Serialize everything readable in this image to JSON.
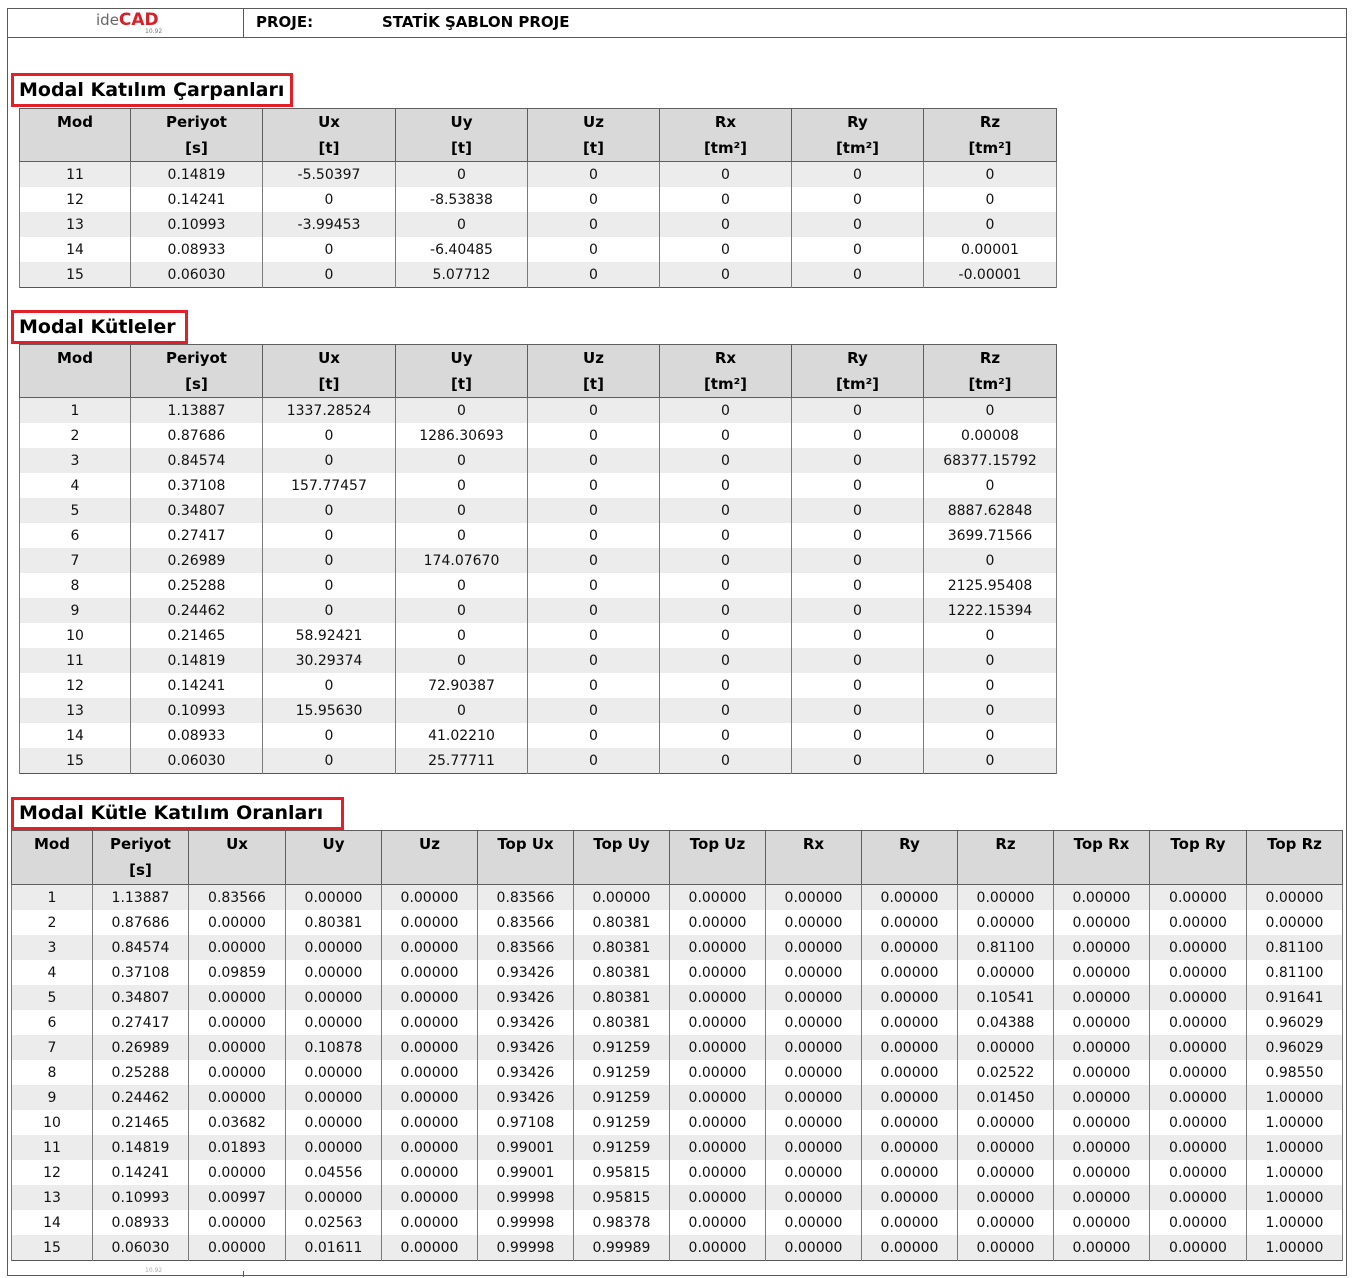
{
  "header": {
    "logo": {
      "prefix": "ide",
      "brand": "CAD",
      "version": "10.92"
    },
    "project_label": "PROJE:",
    "project_name": "STATİK ŞABLON PROJE"
  },
  "colors": {
    "title_border": "#e3202a",
    "header_bg": "#d9d9d9",
    "stripe_bg": "#ececec",
    "brand": "#d71f27"
  },
  "sections": [
    {
      "title": "Modal Katılım Çarpanları",
      "columns": [
        {
          "label": "Mod"
        },
        {
          "label": "Periyot",
          "unit": "[s]"
        },
        {
          "label": "Ux",
          "unit": "[t]"
        },
        {
          "label": "Uy",
          "unit": "[t]"
        },
        {
          "label": "Uz",
          "unit": "[t]"
        },
        {
          "label": "Rx",
          "unit": "[tm²]"
        },
        {
          "label": "Ry",
          "unit": "[tm²]"
        },
        {
          "label": "Rz",
          "unit": "[tm²]"
        }
      ],
      "rows": [
        [
          "11",
          "0.14819",
          "-5.50397",
          "0",
          "0",
          "0",
          "0",
          "0"
        ],
        [
          "12",
          "0.14241",
          "0",
          "-8.53838",
          "0",
          "0",
          "0",
          "0"
        ],
        [
          "13",
          "0.10993",
          "-3.99453",
          "0",
          "0",
          "0",
          "0",
          "0"
        ],
        [
          "14",
          "0.08933",
          "0",
          "-6.40485",
          "0",
          "0",
          "0",
          "0.00001"
        ],
        [
          "15",
          "0.06030",
          "0",
          "5.07712",
          "0",
          "0",
          "0",
          "-0.00001"
        ]
      ]
    },
    {
      "title": "Modal Kütleler",
      "columns": [
        {
          "label": "Mod"
        },
        {
          "label": "Periyot",
          "unit": "[s]"
        },
        {
          "label": "Ux",
          "unit": "[t]"
        },
        {
          "label": "Uy",
          "unit": "[t]"
        },
        {
          "label": "Uz",
          "unit": "[t]"
        },
        {
          "label": "Rx",
          "unit": "[tm²]"
        },
        {
          "label": "Ry",
          "unit": "[tm²]"
        },
        {
          "label": "Rz",
          "unit": "[tm²]"
        }
      ],
      "rows": [
        [
          "1",
          "1.13887",
          "1337.28524",
          "0",
          "0",
          "0",
          "0",
          "0"
        ],
        [
          "2",
          "0.87686",
          "0",
          "1286.30693",
          "0",
          "0",
          "0",
          "0.00008"
        ],
        [
          "3",
          "0.84574",
          "0",
          "0",
          "0",
          "0",
          "0",
          "68377.15792"
        ],
        [
          "4",
          "0.37108",
          "157.77457",
          "0",
          "0",
          "0",
          "0",
          "0"
        ],
        [
          "5",
          "0.34807",
          "0",
          "0",
          "0",
          "0",
          "0",
          "8887.62848"
        ],
        [
          "6",
          "0.27417",
          "0",
          "0",
          "0",
          "0",
          "0",
          "3699.71566"
        ],
        [
          "7",
          "0.26989",
          "0",
          "174.07670",
          "0",
          "0",
          "0",
          "0"
        ],
        [
          "8",
          "0.25288",
          "0",
          "0",
          "0",
          "0",
          "0",
          "2125.95408"
        ],
        [
          "9",
          "0.24462",
          "0",
          "0",
          "0",
          "0",
          "0",
          "1222.15394"
        ],
        [
          "10",
          "0.21465",
          "58.92421",
          "0",
          "0",
          "0",
          "0",
          "0"
        ],
        [
          "11",
          "0.14819",
          "30.29374",
          "0",
          "0",
          "0",
          "0",
          "0"
        ],
        [
          "12",
          "0.14241",
          "0",
          "72.90387",
          "0",
          "0",
          "0",
          "0"
        ],
        [
          "13",
          "0.10993",
          "15.95630",
          "0",
          "0",
          "0",
          "0",
          "0"
        ],
        [
          "14",
          "0.08933",
          "0",
          "41.02210",
          "0",
          "0",
          "0",
          "0"
        ],
        [
          "15",
          "0.06030",
          "0",
          "25.77711",
          "0",
          "0",
          "0",
          "0"
        ]
      ]
    },
    {
      "title": "Modal Kütle Katılım Oranları",
      "columns": [
        {
          "label": "Mod"
        },
        {
          "label": "Periyot",
          "unit": "[s]"
        },
        {
          "label": "Ux"
        },
        {
          "label": "Uy"
        },
        {
          "label": "Uz"
        },
        {
          "label": "Top Ux"
        },
        {
          "label": "Top Uy"
        },
        {
          "label": "Top Uz"
        },
        {
          "label": "Rx"
        },
        {
          "label": "Ry"
        },
        {
          "label": "Rz"
        },
        {
          "label": "Top Rx"
        },
        {
          "label": "Top Ry"
        },
        {
          "label": "Top Rz"
        }
      ],
      "rows": [
        [
          "1",
          "1.13887",
          "0.83566",
          "0.00000",
          "0.00000",
          "0.83566",
          "0.00000",
          "0.00000",
          "0.00000",
          "0.00000",
          "0.00000",
          "0.00000",
          "0.00000",
          "0.00000"
        ],
        [
          "2",
          "0.87686",
          "0.00000",
          "0.80381",
          "0.00000",
          "0.83566",
          "0.80381",
          "0.00000",
          "0.00000",
          "0.00000",
          "0.00000",
          "0.00000",
          "0.00000",
          "0.00000"
        ],
        [
          "3",
          "0.84574",
          "0.00000",
          "0.00000",
          "0.00000",
          "0.83566",
          "0.80381",
          "0.00000",
          "0.00000",
          "0.00000",
          "0.81100",
          "0.00000",
          "0.00000",
          "0.81100"
        ],
        [
          "4",
          "0.37108",
          "0.09859",
          "0.00000",
          "0.00000",
          "0.93426",
          "0.80381",
          "0.00000",
          "0.00000",
          "0.00000",
          "0.00000",
          "0.00000",
          "0.00000",
          "0.81100"
        ],
        [
          "5",
          "0.34807",
          "0.00000",
          "0.00000",
          "0.00000",
          "0.93426",
          "0.80381",
          "0.00000",
          "0.00000",
          "0.00000",
          "0.10541",
          "0.00000",
          "0.00000",
          "0.91641"
        ],
        [
          "6",
          "0.27417",
          "0.00000",
          "0.00000",
          "0.00000",
          "0.93426",
          "0.80381",
          "0.00000",
          "0.00000",
          "0.00000",
          "0.04388",
          "0.00000",
          "0.00000",
          "0.96029"
        ],
        [
          "7",
          "0.26989",
          "0.00000",
          "0.10878",
          "0.00000",
          "0.93426",
          "0.91259",
          "0.00000",
          "0.00000",
          "0.00000",
          "0.00000",
          "0.00000",
          "0.00000",
          "0.96029"
        ],
        [
          "8",
          "0.25288",
          "0.00000",
          "0.00000",
          "0.00000",
          "0.93426",
          "0.91259",
          "0.00000",
          "0.00000",
          "0.00000",
          "0.02522",
          "0.00000",
          "0.00000",
          "0.98550"
        ],
        [
          "9",
          "0.24462",
          "0.00000",
          "0.00000",
          "0.00000",
          "0.93426",
          "0.91259",
          "0.00000",
          "0.00000",
          "0.00000",
          "0.01450",
          "0.00000",
          "0.00000",
          "1.00000"
        ],
        [
          "10",
          "0.21465",
          "0.03682",
          "0.00000",
          "0.00000",
          "0.97108",
          "0.91259",
          "0.00000",
          "0.00000",
          "0.00000",
          "0.00000",
          "0.00000",
          "0.00000",
          "1.00000"
        ],
        [
          "11",
          "0.14819",
          "0.01893",
          "0.00000",
          "0.00000",
          "0.99001",
          "0.91259",
          "0.00000",
          "0.00000",
          "0.00000",
          "0.00000",
          "0.00000",
          "0.00000",
          "1.00000"
        ],
        [
          "12",
          "0.14241",
          "0.00000",
          "0.04556",
          "0.00000",
          "0.99001",
          "0.95815",
          "0.00000",
          "0.00000",
          "0.00000",
          "0.00000",
          "0.00000",
          "0.00000",
          "1.00000"
        ],
        [
          "13",
          "0.10993",
          "0.00997",
          "0.00000",
          "0.00000",
          "0.99998",
          "0.95815",
          "0.00000",
          "0.00000",
          "0.00000",
          "0.00000",
          "0.00000",
          "0.00000",
          "1.00000"
        ],
        [
          "14",
          "0.08933",
          "0.00000",
          "0.02563",
          "0.00000",
          "0.99998",
          "0.98378",
          "0.00000",
          "0.00000",
          "0.00000",
          "0.00000",
          "0.00000",
          "0.00000",
          "1.00000"
        ],
        [
          "15",
          "0.06030",
          "0.00000",
          "0.01611",
          "0.00000",
          "0.99998",
          "0.99989",
          "0.00000",
          "0.00000",
          "0.00000",
          "0.00000",
          "0.00000",
          "0.00000",
          "1.00000"
        ]
      ]
    }
  ],
  "footer": {
    "version": "10.92"
  }
}
